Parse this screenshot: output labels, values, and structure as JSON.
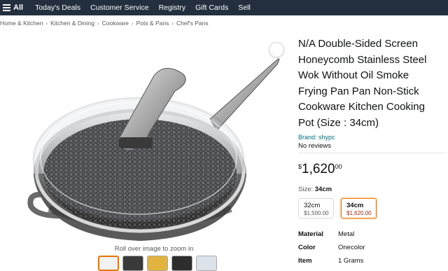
{
  "nav": {
    "all_label": "All",
    "links": [
      "Today's Deals",
      "Customer Service",
      "Registry",
      "Gift Cards",
      "Sell"
    ]
  },
  "breadcrumb": [
    "Home & Kitchen",
    "Kitchen & Dining",
    "Cookware",
    "Pots & Pans",
    "Chef's Pans"
  ],
  "breadcrumb_separator": "›",
  "gallery": {
    "zoom_hint": "Roll over image to zoom in",
    "thumbnail_count": 5
  },
  "product": {
    "title_lines": [
      "N/A Double-Sided Screen",
      "Honeycomb Stainless Steel",
      "Wok Without Oil Smoke",
      "Frying Pan Pan Non-Stick",
      "Cookware Kitchen Cooking",
      "Pot (Size : 34cm)"
    ],
    "brand": "Brand: shypc",
    "reviews": "No reviews",
    "price": {
      "symbol": "$",
      "whole": "1,620",
      "fraction": "00"
    }
  },
  "size": {
    "label": "Size:",
    "selected": "34cm",
    "options": [
      {
        "name": "32cm",
        "price": "$1,500.00",
        "selected": false
      },
      {
        "name": "34cm",
        "price": "$1,620.00",
        "selected": true
      }
    ]
  },
  "specs": [
    {
      "key": "Material",
      "value": "Metal"
    },
    {
      "key": "Color",
      "value": "Onecolor"
    },
    {
      "key": "Item",
      "value": "1 Grams"
    }
  ],
  "colors": {
    "nav_bg": "#232f3e",
    "link": "#007185",
    "selected_border": "#e77600",
    "selected_price": "#b12704"
  }
}
